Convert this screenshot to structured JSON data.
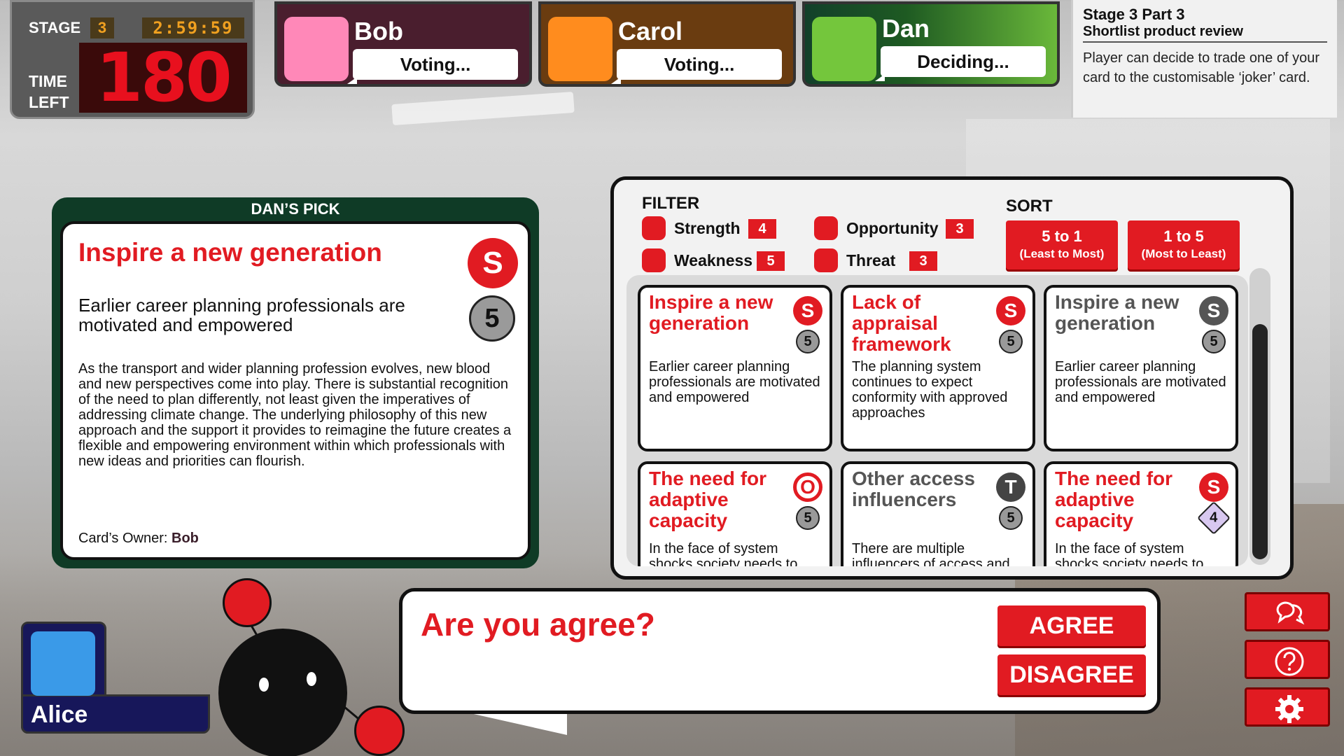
{
  "stage": {
    "label": "STAGE",
    "number": "3",
    "clock": "2:59:59",
    "time_left_label_1": "TIME",
    "time_left_label_2": "LEFT",
    "time_left_value": "180"
  },
  "players": [
    {
      "name": "Bob",
      "status": "Voting...",
      "color": "#ff88b8",
      "bg": "#4a1e2e"
    },
    {
      "name": "Carol",
      "status": "Voting...",
      "color": "#ff8c1e",
      "bg": "#6a3c10"
    },
    {
      "name": "Dan",
      "status": "Deciding...",
      "color": "#74c63c",
      "bg": "#1e5a22"
    }
  ],
  "stage_info": {
    "title": "Stage 3 Part 3",
    "subtitle": "Shortlist product review",
    "description": "Player can decide to trade one of your card to the customisable ‘joker’ card."
  },
  "pick": {
    "heading": "DAN’S PICK",
    "title": "Inspire a new generation",
    "badge": "S",
    "subtitle": "Earlier career planning professionals are motivated and empowered",
    "number": "5",
    "body": "As the transport and wider planning profession evolves, new blood and new perspectives come into play. There is substantial recognition of the need to plan differently, not least given the imperatives of addressing climate change. The underlying philosophy of this new approach and the support it provides to reimagine the future creates a flexible and empowering environment within which professionals with new ideas and priorities can flourish.",
    "owner_label": "Card’s Owner:",
    "owner_name": "Bob"
  },
  "filter": {
    "label": "FILTER",
    "items": [
      {
        "name": "Strength",
        "count": "4"
      },
      {
        "name": "Weakness",
        "count": "5"
      },
      {
        "name": "Opportunity",
        "count": "3"
      },
      {
        "name": "Threat",
        "count": "3"
      }
    ]
  },
  "sort": {
    "label": "SORT",
    "buttons": [
      {
        "line1": "5 to 1",
        "line2": "(Least to Most)"
      },
      {
        "line1": "1 to 5",
        "line2": "(Most to Least)"
      }
    ]
  },
  "cards": [
    {
      "title": "Inspire a new generation",
      "badge": "S",
      "number": "5",
      "desc": "Earlier career planning professionals are motivated and empowered",
      "title_color": "#e11b22",
      "badge_color": "#e11b22"
    },
    {
      "title": "Lack of appraisal framework",
      "badge": "S",
      "number": "5",
      "desc": "The planning system continues to expect conformity with approved approaches",
      "title_color": "#e11b22",
      "badge_color": "#e11b22"
    },
    {
      "title": "Inspire a new generation",
      "badge": "S",
      "number": "5",
      "desc": "Earlier career planning professionals are motivated and empowered",
      "title_color": "#555555",
      "badge_color": "#555555"
    },
    {
      "title": "The need for adaptive capacity",
      "badge": "O",
      "number": "5",
      "desc": "In the face of system shocks society needs to",
      "title_color": "#e11b22",
      "badge_color": "#e11b22"
    },
    {
      "title": "Other access influencers",
      "badge": "T",
      "number": "5",
      "desc": "There are multiple influencers of access and",
      "title_color": "#555555",
      "badge_color": "#555555"
    },
    {
      "title": "The need for adaptive capacity",
      "badge": "S",
      "number": "4",
      "desc": "In the face of system shocks society needs to",
      "title_color": "#e11b22",
      "badge_color": "#e11b22"
    }
  ],
  "local_player": {
    "name": "Alice",
    "color": "#3a9ae8"
  },
  "question": {
    "text": "Are you agree?",
    "agree": "AGREE",
    "disagree": "DISAGREE"
  },
  "side_icons": [
    "chat-icon",
    "help-icon",
    "gear-icon"
  ]
}
